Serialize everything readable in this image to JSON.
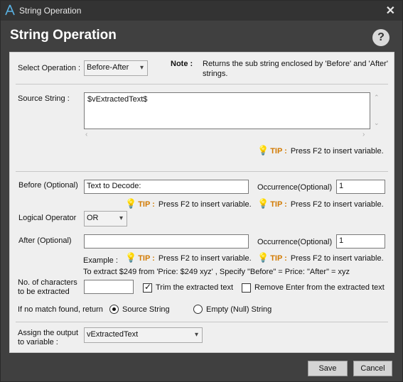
{
  "window": {
    "title": "String Operation",
    "close_icon": "close-icon",
    "app_icon": "app-logo-icon"
  },
  "header": {
    "title": "String Operation",
    "help_symbol": "?"
  },
  "select_operation": {
    "label": "Select Operation :",
    "value": "Before-After"
  },
  "note": {
    "label": "Note :",
    "text_line1": "Returns the sub string enclosed by 'Before' and 'After'",
    "text_line2": "strings."
  },
  "source_string": {
    "label": "Source String :",
    "value": "$vExtractedText$"
  },
  "tip": {
    "label": "TIP :",
    "text": "Press F2 to insert variable."
  },
  "before": {
    "label": "Before (Optional)",
    "value": "Text to Decode:"
  },
  "occurrence1": {
    "label": "Occurrence(Optional)",
    "value": "1"
  },
  "logical_operator": {
    "label": "Logical Operator",
    "value": "OR"
  },
  "after": {
    "label": "After (Optional)",
    "value": ""
  },
  "occurrence2": {
    "label": "Occurrence(Optional)",
    "value": "1"
  },
  "example": {
    "label": "Example :",
    "text": "To extract $249 from 'Price: $249 xyz' , Specify \"Before\" = Price:  \"After\" = xyz"
  },
  "num_chars": {
    "label_line1": "No. of characters",
    "label_line2": "to be extracted",
    "value": ""
  },
  "trim": {
    "label": "Trim the extracted text",
    "checked": true
  },
  "remove_enter": {
    "label": "Remove Enter from the extracted text",
    "checked": false
  },
  "no_match": {
    "label": "If no match found, return",
    "option1": "Source String",
    "option2": "Empty (Null) String",
    "selected": "Source String"
  },
  "assign": {
    "label_line1": "Assign the output",
    "label_line2": "to variable :",
    "value": "vExtractedText"
  },
  "buttons": {
    "save": "Save",
    "cancel": "Cancel"
  }
}
